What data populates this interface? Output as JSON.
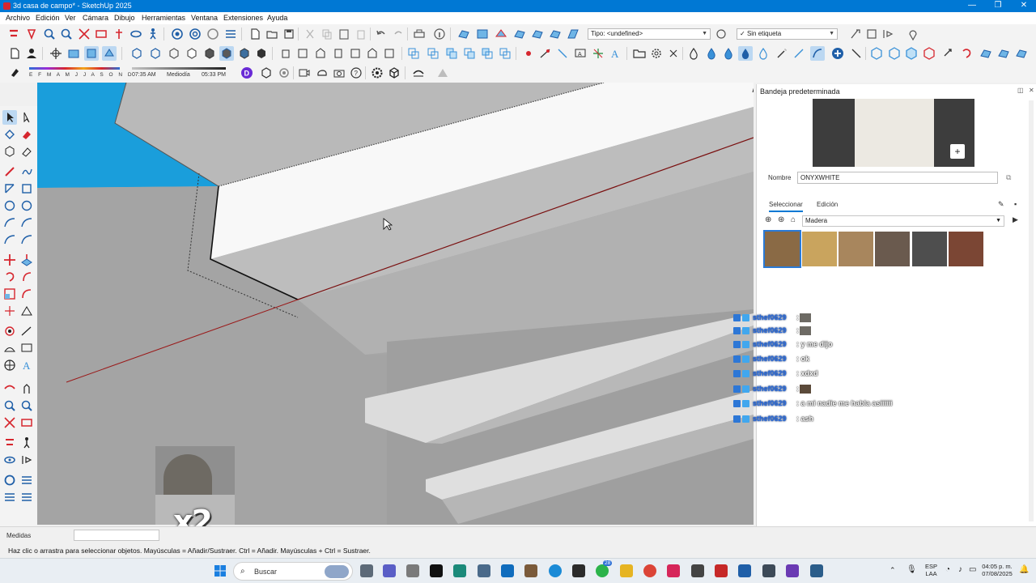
{
  "window": {
    "title": "3d casa de campo* - SketchUp 2025",
    "controls": [
      "—",
      "❐",
      "✕"
    ]
  },
  "menu": [
    "Archivo",
    "Edición",
    "Ver",
    "Cámara",
    "Dibujo",
    "Herramientas",
    "Ventana",
    "Extensiones",
    "Ayuda"
  ],
  "toolbar": {
    "tipo_dropdown": "Tipo: <undefined>",
    "etiqueta_dropdown": "Sin etiqueta",
    "months": "E F M A M J J A S O N D",
    "time_start": "07:35 AM",
    "time_mid": "Mediodía",
    "time_end": "05:33 PM"
  },
  "panel": {
    "title": "Bandeja predeterminada",
    "name_label": "Nombre",
    "name_value": "ONYXWHITE",
    "tabs": [
      "Seleccionar",
      "Edición"
    ],
    "library": "Madera",
    "swatch_colors": [
      "#8a6a45",
      "#c9a45e",
      "#a8865d",
      "#6a5a4e",
      "#4e4e4e",
      "#7b4634"
    ]
  },
  "chat": {
    "messages": [
      {
        "user": "sthef0629",
        "text": ":",
        "emote": true
      },
      {
        "user": "sthef0629",
        "text": ":",
        "emote": true
      },
      {
        "user": "sthef0629",
        "text": ": y me dijo",
        "emote": false
      },
      {
        "user": "sthef0629",
        "text": ": ok",
        "emote": false
      },
      {
        "user": "sthef0629",
        "text": ": xdxd",
        "emote": false
      },
      {
        "user": "sthef0629",
        "text": ":",
        "emote": true
      },
      {
        "user": "sthef0629",
        "text": ": a mi nadie me habla asiiiiii",
        "emote": false
      },
      {
        "user": "sthef0629",
        "text": ": ash",
        "emote": false
      }
    ]
  },
  "overlay": {
    "multiplier": "x2"
  },
  "status": {
    "measure_label": "Medidas",
    "hint": "Haz clic o arrastra para seleccionar objetos. Mayúsculas = Añadir/Sustraer. Ctrl = Añadir. Mayúsculas + Ctrl = Sustraer."
  },
  "taskbar": {
    "search_placeholder": "Buscar",
    "lang": "ESP",
    "lang_sub": "LAA",
    "time": "04:05 p. m.",
    "date": "07/08/2025",
    "badge": "28"
  }
}
